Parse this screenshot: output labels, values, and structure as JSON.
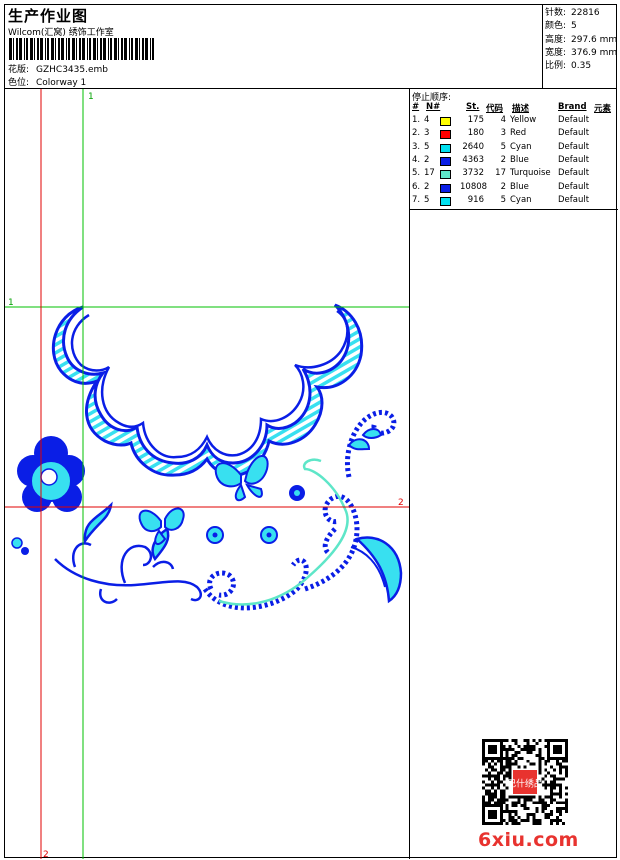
{
  "header": {
    "title": "生产作业图",
    "company": "Wilcom(汇窝) 绣饰工作室",
    "pattern_label": "花版:",
    "pattern_value": "GZHC3435.emb",
    "colorway_label": "色位:",
    "colorway_value": "Colorway 1"
  },
  "stats": {
    "stitches_label": "针数:",
    "stitches_value": "22816",
    "colors_label": "颜色:",
    "colors_value": "5",
    "height_label": "高度:",
    "height_value": "297.6 mm",
    "width_label": "宽度:",
    "width_value": "376.9 mm",
    "scale_label": "比例:",
    "scale_value": "0.35"
  },
  "guides": {
    "v1_label": "1",
    "v2_label": "2",
    "h1_label": "1",
    "h2_label": "2"
  },
  "stop_sequence": {
    "title": "停止顺序:",
    "headers": {
      "num": "#",
      "needle": "N#",
      "stitches": "St.",
      "code": "代码",
      "desc": "描述",
      "brand": "Brand",
      "element": "元素"
    },
    "rows": [
      {
        "num": "1.",
        "needle": "4",
        "color": "#ffff00",
        "stitches": "175",
        "code": "4",
        "desc": "Yellow",
        "brand": "Default"
      },
      {
        "num": "2.",
        "needle": "3",
        "color": "#ff0000",
        "stitches": "180",
        "code": "3",
        "desc": "Red",
        "brand": "Default"
      },
      {
        "num": "3.",
        "needle": "5",
        "color": "#00e0f0",
        "stitches": "2640",
        "code": "5",
        "desc": "Cyan",
        "brand": "Default"
      },
      {
        "num": "4.",
        "needle": "2",
        "color": "#0a1ee6",
        "stitches": "4363",
        "code": "2",
        "desc": "Blue",
        "brand": "Default"
      },
      {
        "num": "5.",
        "needle": "17",
        "color": "#5ee6c8",
        "stitches": "3732",
        "code": "17",
        "desc": "Turquoise",
        "brand": "Default"
      },
      {
        "num": "6.",
        "needle": "2",
        "color": "#0a1ee6",
        "stitches": "10808",
        "code": "2",
        "desc": "Blue",
        "brand": "Default"
      },
      {
        "num": "7.",
        "needle": "5",
        "color": "#00e0f0",
        "stitches": "916",
        "code": "5",
        "desc": "Cyan",
        "brand": "Default"
      }
    ]
  },
  "watermark": {
    "text": "6xiu.com",
    "seal": "巴什绣品",
    "color": "#e8332f"
  },
  "colors": {
    "blue": "#0a1ee6",
    "cyan": "#38e0f0",
    "turquoise": "#5ee6c8",
    "guide_green": "#00c000",
    "guide_red": "#e00000"
  }
}
